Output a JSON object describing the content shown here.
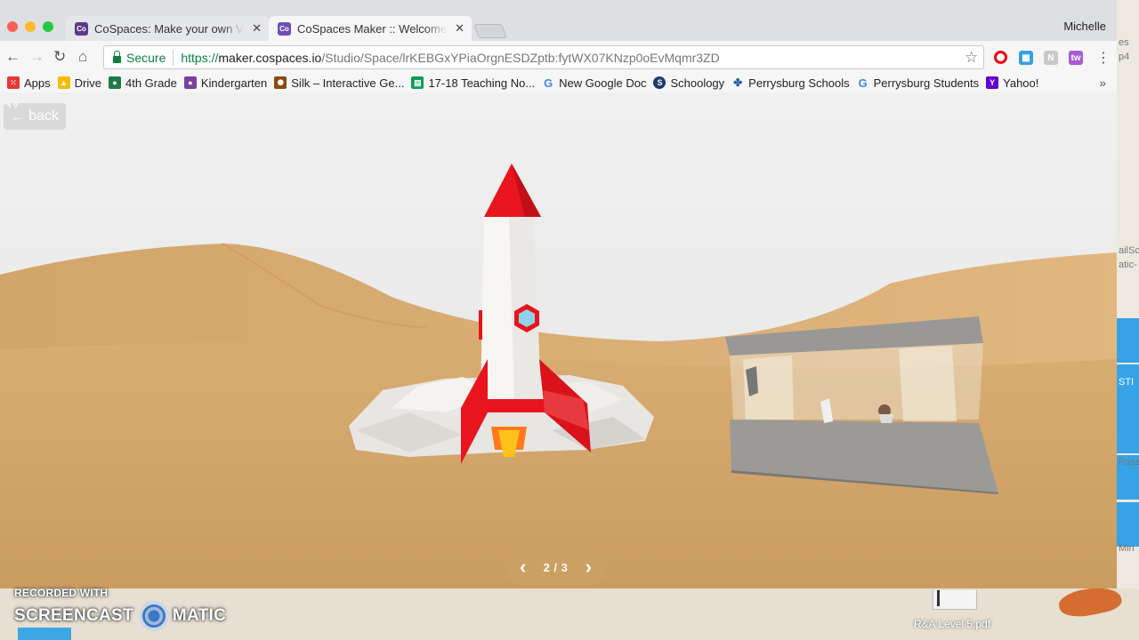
{
  "browser": {
    "tabs": [
      {
        "title": "CoSpaces: Make your own VR",
        "favicon": "cospaces-favicon",
        "active": false
      },
      {
        "title": "CoSpaces Maker :: Welcome to",
        "favicon": "cospaces-favicon",
        "active": true
      }
    ],
    "user": "Michelle",
    "address": {
      "secure_label": "Secure",
      "scheme": "https://",
      "host": "maker.cospaces.io",
      "path": "/Studio/Space/lrKEBGxYPiaOrgnESDZptb:fytWX07KNzp0oEvMqmr3ZD"
    },
    "bookmarks": [
      {
        "label": "Apps",
        "icon": "apps-grid-icon",
        "color": "#e53935"
      },
      {
        "label": "Drive",
        "icon": "drive-icon",
        "color": "#fbbc04"
      },
      {
        "label": "4th Grade",
        "icon": "classroom-icon",
        "color": "#1e7a46"
      },
      {
        "label": "Kindergarten",
        "icon": "classroom-icon",
        "color": "#7b3fa0"
      },
      {
        "label": "Silk – Interactive Ge...",
        "icon": "silk-icon",
        "color": "#8a4b12"
      },
      {
        "label": "17-18 Teaching No...",
        "icon": "sheets-icon",
        "color": "#0f9d58"
      },
      {
        "label": "New Google Doc",
        "icon": "google-icon",
        "color": "#4285f4"
      },
      {
        "label": "Schoology",
        "icon": "schoology-icon",
        "color": "#1d3b6e"
      },
      {
        "label": "Perrysburg Schools",
        "icon": "perrysburg-icon",
        "color": "#2a5aa8"
      },
      {
        "label": "Perrysburg Students",
        "icon": "google-icon",
        "color": "#4285f4"
      },
      {
        "label": "Yahoo!",
        "icon": "yahoo-icon",
        "color": "#6001d2"
      }
    ]
  },
  "scene": {
    "back_label": "back",
    "pager": {
      "label": "2 / 3",
      "current": 2,
      "total": 3
    },
    "colors": {
      "sand": "#d6a96c",
      "rocket_red": "#e8141e",
      "rocket_body": "#f5f5f3",
      "window_blue": "#8fd3ea"
    }
  },
  "desktop": {
    "watermark_top": "RECORDED WITH",
    "watermark_left": "SCREENCAST",
    "watermark_right": "MATIC",
    "file_label": "R&A Level 5.pdf",
    "right_labels": [
      "es",
      "p4",
      "ailSc",
      "atic-",
      "STI",
      "Pass",
      "Min"
    ]
  }
}
